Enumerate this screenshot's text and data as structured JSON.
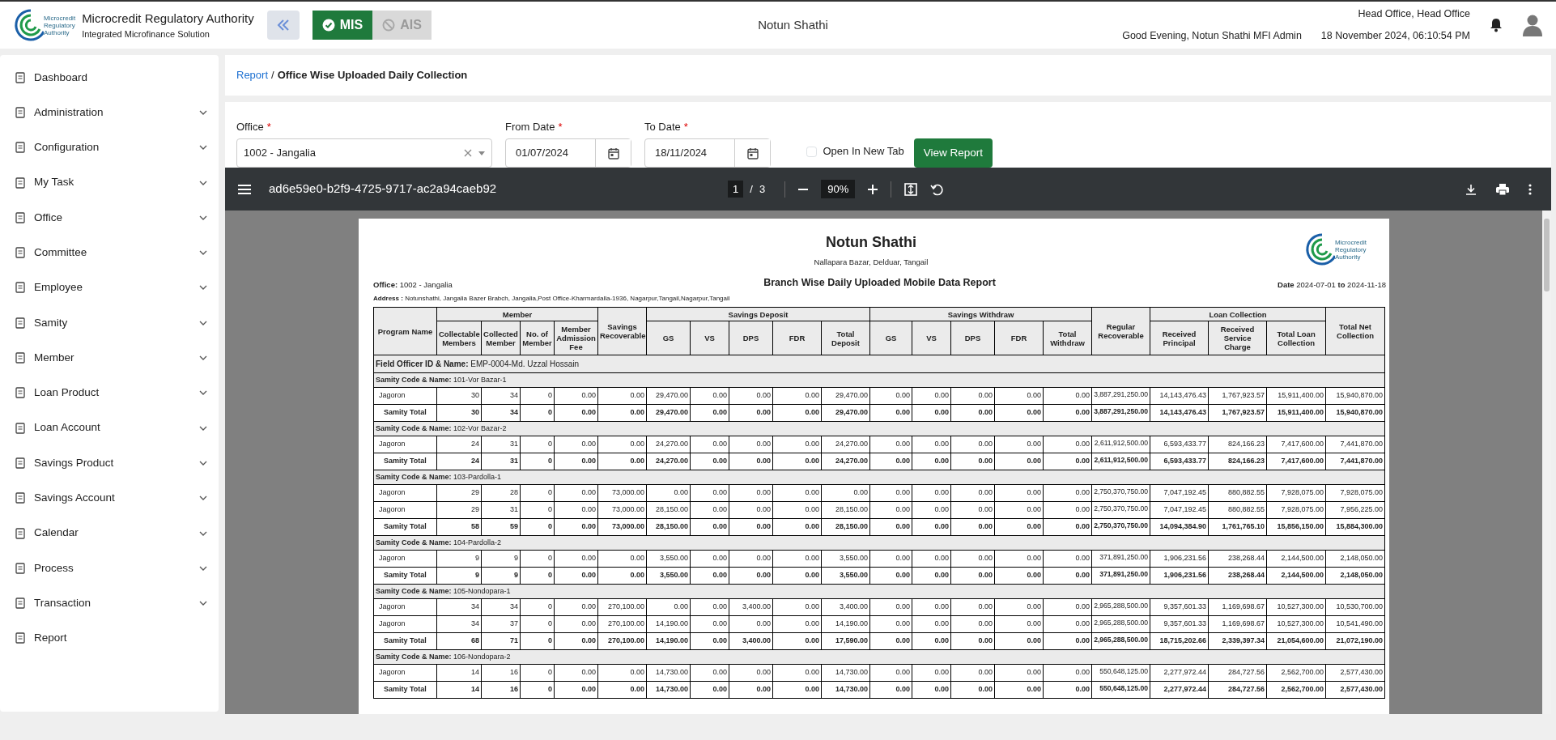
{
  "header": {
    "org_name": "Microcredit Regulatory Authority",
    "org_subtitle": "Integrated Microfinance Solution",
    "logo_text": [
      "Microcredit",
      "Regulatory",
      "Authority"
    ],
    "modules": [
      {
        "label": "MIS",
        "selected": true
      },
      {
        "label": "AIS",
        "selected": false
      }
    ],
    "center_title": "Notun Shathi",
    "office": "Head Office, Head Office",
    "greeting": "Good Evening, Notun Shathi MFI Admin",
    "datetime": "18 November 2024, 06:10:54 PM"
  },
  "sidebar": {
    "items": [
      {
        "label": "Dashboard",
        "expandable": false
      },
      {
        "label": "Administration",
        "expandable": true
      },
      {
        "label": "Configuration",
        "expandable": true
      },
      {
        "label": "My Task",
        "expandable": true
      },
      {
        "label": "Office",
        "expandable": true
      },
      {
        "label": "Committee",
        "expandable": true
      },
      {
        "label": "Employee",
        "expandable": true
      },
      {
        "label": "Samity",
        "expandable": true
      },
      {
        "label": "Member",
        "expandable": true
      },
      {
        "label": "Loan Product",
        "expandable": true
      },
      {
        "label": "Loan Account",
        "expandable": true
      },
      {
        "label": "Savings Product",
        "expandable": true
      },
      {
        "label": "Savings Account",
        "expandable": true
      },
      {
        "label": "Calendar",
        "expandable": true
      },
      {
        "label": "Process",
        "expandable": true
      },
      {
        "label": "Transaction",
        "expandable": true
      },
      {
        "label": "Report",
        "expandable": false
      }
    ]
  },
  "breadcrumb": {
    "items": [
      "Report",
      "Office Wise Uploaded Daily Collection"
    ],
    "separator": "/"
  },
  "filters": {
    "office": {
      "label": "Office",
      "required_mark": "*",
      "value": "1002 - Jangalia"
    },
    "from_date": {
      "label": "From Date",
      "required_mark": "*",
      "value": "01/07/2024"
    },
    "to_date": {
      "label": "To Date",
      "required_mark": "*",
      "value": "18/11/2024"
    },
    "open_new_tab": {
      "label": "Open In New Tab",
      "checked": false
    },
    "view_button": "View Report"
  },
  "viewer": {
    "file_name": "ad6e59e0-b2f9-4725-9717-ac2a94caeb92",
    "page": "1",
    "page_separator": "/",
    "page_count": "3",
    "zoom": "90%"
  },
  "report": {
    "company": "Notun Shathi",
    "company_address": "Nallapara Bazar, Delduar, Tangail",
    "logo_text": [
      "Microcredit",
      "Regulatory",
      "Authority"
    ],
    "office": "**Office:** 1002 - Jangalia",
    "title": "Branch Wise Daily Uploaded Mobile Data Report",
    "date_range": "**Date** 2024-07-01 **to** 2024-11-18",
    "address": "**Address :** Notunshathi, Jangalia Bazer Brabch, Jangalia,Post Office-Kharmardalla-1936, Nagarpur,Tangail,Nagarpur,Tangail",
    "header": [
      {
        "label": "Program Name"
      },
      {
        "label": "Member",
        "children": [
          "Collectable Members",
          "Collected Member",
          "No. of Member",
          "Member Admission Fee"
        ]
      },
      {
        "label": "Savings Recoverable"
      },
      {
        "label": "Savings Deposit",
        "children": [
          "GS",
          "VS",
          "DPS",
          "FDR",
          "Total Deposit"
        ]
      },
      {
        "label": "Savings Withdraw",
        "children": [
          "GS",
          "VS",
          "DPS",
          "FDR",
          "Total Withdraw"
        ]
      },
      {
        "label": "Regular Recoverable"
      },
      {
        "label": "Loan Collection",
        "children": [
          "Received Principal",
          "Received Service Charge",
          "Total Loan Collection"
        ]
      },
      {
        "label": "Total Net Collection"
      }
    ],
    "field_officer": "**Field Officer ID & Name:** EMP-0004-Md. Uzzal Hossain",
    "samities": [
      {
        "label": "**Samity Code & Name:** 101-Vor Bazar-1",
        "rows": [
          {
            "program": "Jagoron",
            "values": [
              "30",
              "34",
              "0",
              "0.00",
              "0.00",
              "29,470.00",
              "0.00",
              "0.00",
              "0.00",
              "29,470.00",
              "0.00",
              "0.00",
              "0.00",
              "0.00",
              "0.00",
              "3,887,291,250.00",
              "14,143,476.43",
              "1,767,923.57",
              "15,911,400.00",
              "15,940,870.00"
            ]
          }
        ],
        "total": {
          "label": "Samity Total",
          "values": [
            "30",
            "34",
            "0",
            "0.00",
            "0.00",
            "29,470.00",
            "0.00",
            "0.00",
            "0.00",
            "29,470.00",
            "0.00",
            "0.00",
            "0.00",
            "0.00",
            "0.00",
            "3,887,291,250.00",
            "14,143,476.43",
            "1,767,923.57",
            "15,911,400.00",
            "15,940,870.00"
          ]
        }
      },
      {
        "label": "**Samity Code & Name:** 102-Vor Bazar-2",
        "rows": [
          {
            "program": "Jagoron",
            "values": [
              "24",
              "31",
              "0",
              "0.00",
              "0.00",
              "24,270.00",
              "0.00",
              "0.00",
              "0.00",
              "24,270.00",
              "0.00",
              "0.00",
              "0.00",
              "0.00",
              "0.00",
              "2,611,912,500.00",
              "6,593,433.77",
              "824,166.23",
              "7,417,600.00",
              "7,441,870.00"
            ]
          }
        ],
        "total": {
          "label": "Samity Total",
          "values": [
            "24",
            "31",
            "0",
            "0.00",
            "0.00",
            "24,270.00",
            "0.00",
            "0.00",
            "0.00",
            "24,270.00",
            "0.00",
            "0.00",
            "0.00",
            "0.00",
            "0.00",
            "2,611,912,500.00",
            "6,593,433.77",
            "824,166.23",
            "7,417,600.00",
            "7,441,870.00"
          ]
        }
      },
      {
        "label": "**Samity Code & Name:** 103-Pardolla-1",
        "rows": [
          {
            "program": "Jagoron",
            "values": [
              "29",
              "28",
              "0",
              "0.00",
              "73,000.00",
              "0.00",
              "0.00",
              "0.00",
              "0.00",
              "0.00",
              "0.00",
              "0.00",
              "0.00",
              "0.00",
              "0.00",
              "2,750,370,750.00",
              "7,047,192.45",
              "880,882.55",
              "7,928,075.00",
              "7,928,075.00"
            ]
          },
          {
            "program": "Jagoron",
            "values": [
              "29",
              "31",
              "0",
              "0.00",
              "73,000.00",
              "28,150.00",
              "0.00",
              "0.00",
              "0.00",
              "28,150.00",
              "0.00",
              "0.00",
              "0.00",
              "0.00",
              "0.00",
              "2,750,370,750.00",
              "7,047,192.45",
              "880,882.55",
              "7,928,075.00",
              "7,956,225.00"
            ]
          }
        ],
        "total": {
          "label": "Samity Total",
          "values": [
            "58",
            "59",
            "0",
            "0.00",
            "73,000.00",
            "28,150.00",
            "0.00",
            "0.00",
            "0.00",
            "28,150.00",
            "0.00",
            "0.00",
            "0.00",
            "0.00",
            "0.00",
            "2,750,370,750.00",
            "14,094,384.90",
            "1,761,765.10",
            "15,856,150.00",
            "15,884,300.00"
          ]
        }
      },
      {
        "label": "**Samity Code & Name:** 104-Pardolla-2",
        "rows": [
          {
            "program": "Jagoron",
            "values": [
              "9",
              "9",
              "0",
              "0.00",
              "0.00",
              "3,550.00",
              "0.00",
              "0.00",
              "0.00",
              "3,550.00",
              "0.00",
              "0.00",
              "0.00",
              "0.00",
              "0.00",
              "371,891,250.00",
              "1,906,231.56",
              "238,268.44",
              "2,144,500.00",
              "2,148,050.00"
            ]
          }
        ],
        "total": {
          "label": "Samity Total",
          "values": [
            "9",
            "9",
            "0",
            "0.00",
            "0.00",
            "3,550.00",
            "0.00",
            "0.00",
            "0.00",
            "3,550.00",
            "0.00",
            "0.00",
            "0.00",
            "0.00",
            "0.00",
            "371,891,250.00",
            "1,906,231.56",
            "238,268.44",
            "2,144,500.00",
            "2,148,050.00"
          ]
        }
      },
      {
        "label": "**Samity Code & Name:** 105-Nondopara-1",
        "rows": [
          {
            "program": "Jagoron",
            "values": [
              "34",
              "34",
              "0",
              "0.00",
              "270,100.00",
              "0.00",
              "0.00",
              "3,400.00",
              "0.00",
              "3,400.00",
              "0.00",
              "0.00",
              "0.00",
              "0.00",
              "0.00",
              "2,965,288,500.00",
              "9,357,601.33",
              "1,169,698.67",
              "10,527,300.00",
              "10,530,700.00"
            ]
          },
          {
            "program": "Jagoron",
            "values": [
              "34",
              "37",
              "0",
              "0.00",
              "270,100.00",
              "14,190.00",
              "0.00",
              "0.00",
              "0.00",
              "14,190.00",
              "0.00",
              "0.00",
              "0.00",
              "0.00",
              "0.00",
              "2,965,288,500.00",
              "9,357,601.33",
              "1,169,698.67",
              "10,527,300.00",
              "10,541,490.00"
            ]
          }
        ],
        "total": {
          "label": "Samity Total",
          "values": [
            "68",
            "71",
            "0",
            "0.00",
            "270,100.00",
            "14,190.00",
            "0.00",
            "3,400.00",
            "0.00",
            "17,590.00",
            "0.00",
            "0.00",
            "0.00",
            "0.00",
            "0.00",
            "2,965,288,500.00",
            "18,715,202.66",
            "2,339,397.34",
            "21,054,600.00",
            "21,072,190.00"
          ]
        }
      },
      {
        "label": "**Samity Code & Name:** 106-Nondopara-2",
        "rows": [
          {
            "program": "Jagoron",
            "values": [
              "14",
              "16",
              "0",
              "0.00",
              "0.00",
              "14,730.00",
              "0.00",
              "0.00",
              "0.00",
              "14,730.00",
              "0.00",
              "0.00",
              "0.00",
              "0.00",
              "0.00",
              "550,648,125.00",
              "2,277,972.44",
              "284,727.56",
              "2,562,700.00",
              "2,577,430.00"
            ]
          }
        ],
        "total": {
          "label": "Samity Total",
          "values": [
            "14",
            "16",
            "0",
            "0.00",
            "0.00",
            "14,730.00",
            "0.00",
            "0.00",
            "0.00",
            "14,730.00",
            "0.00",
            "0.00",
            "0.00",
            "0.00",
            "0.00",
            "550,648,125.00",
            "2,277,972.44",
            "284,727.56",
            "2,562,700.00",
            "2,577,430.00"
          ]
        }
      }
    ]
  }
}
